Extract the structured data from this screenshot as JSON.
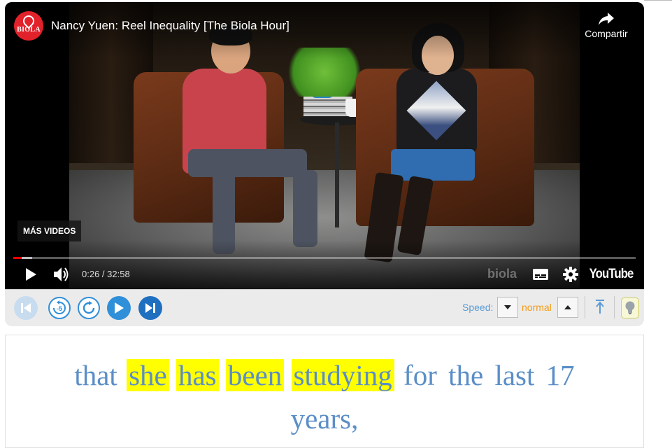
{
  "video": {
    "channel_logo_text": "BIOLA",
    "title": "Nancy Yuen: Reel Inequality [The Biola Hour]",
    "share_label": "Compartir",
    "more_videos_label": "MÁS VIDEOS",
    "time_display": "0:26 / 32:58",
    "progress_fraction": 0.013,
    "watermark": "biola",
    "youtube_label": "YouTube",
    "icons": [
      "play-icon",
      "volume-icon",
      "subtitles-icon",
      "settings-icon",
      "share-icon"
    ]
  },
  "toolbar": {
    "buttons": [
      "first-icon",
      "replay-5-icon",
      "repeat-icon",
      "play-icon",
      "skip-next-icon"
    ],
    "speed_label": "Speed:",
    "speed_value": "normal",
    "accent": "#2f8fd8",
    "speed_color": "#f39c12"
  },
  "transcript": {
    "words": [
      {
        "text": "that",
        "highlighted": false
      },
      {
        "text": "she",
        "highlighted": true
      },
      {
        "text": "has",
        "highlighted": true
      },
      {
        "text": "been",
        "highlighted": true
      },
      {
        "text": "studying",
        "highlighted": true
      },
      {
        "text": "for",
        "highlighted": false
      },
      {
        "text": "the",
        "highlighted": false
      },
      {
        "text": "last",
        "highlighted": false
      },
      {
        "text": "17",
        "highlighted": false
      },
      {
        "text": "years,",
        "highlighted": false
      }
    ],
    "text_color": "#5b8ec7",
    "highlight_color": "#ffff00"
  }
}
